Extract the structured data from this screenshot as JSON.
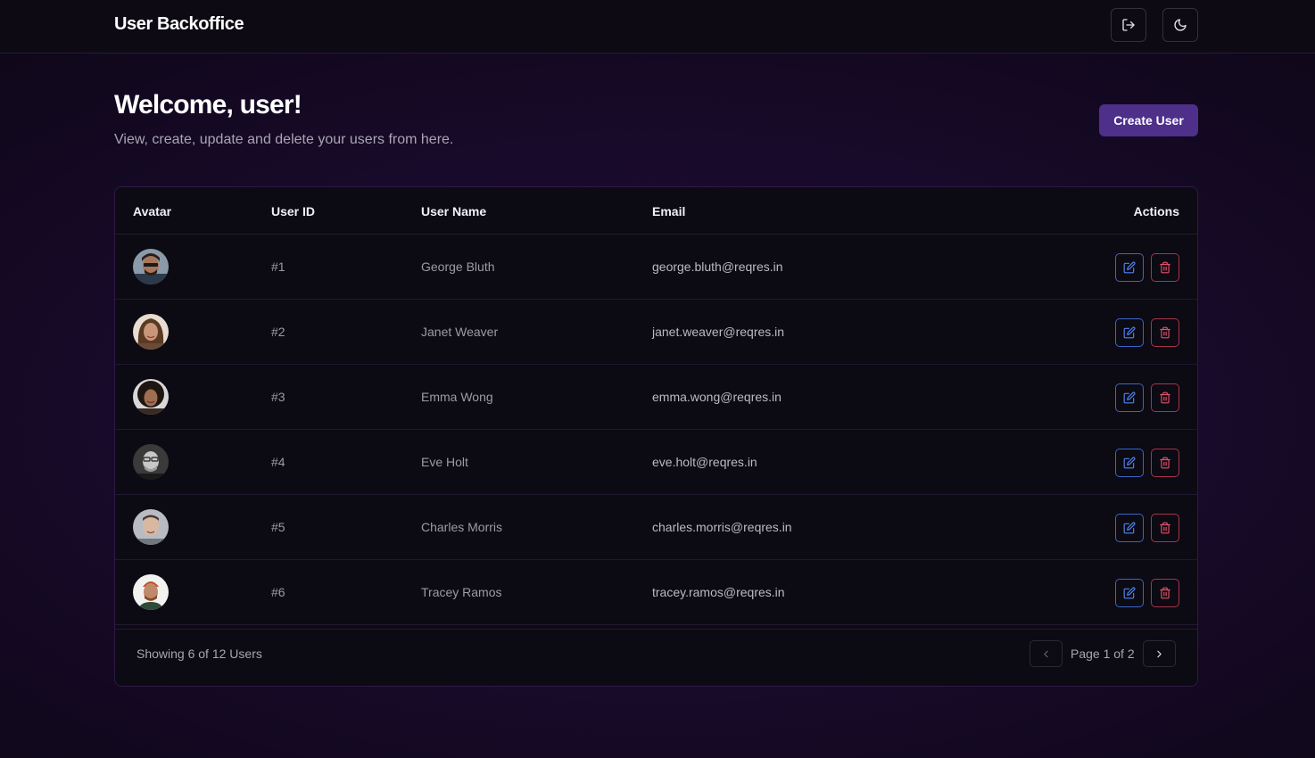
{
  "header": {
    "title": "User Backoffice",
    "logout_icon": "logout-icon",
    "theme_icon": "moon-icon"
  },
  "welcome": {
    "heading": "Welcome, user!",
    "subtitle": "View, create, update and delete your users from here."
  },
  "toolbar": {
    "create_label": "Create User"
  },
  "table": {
    "columns": [
      "Avatar",
      "User ID",
      "User Name",
      "Email",
      "Actions"
    ],
    "rows": [
      {
        "id": "#1",
        "name": "George Bluth",
        "email": "george.bluth@reqres.in"
      },
      {
        "id": "#2",
        "name": "Janet Weaver",
        "email": "janet.weaver@reqres.in"
      },
      {
        "id": "#3",
        "name": "Emma Wong",
        "email": "emma.wong@reqres.in"
      },
      {
        "id": "#4",
        "name": "Eve Holt",
        "email": "eve.holt@reqres.in"
      },
      {
        "id": "#5",
        "name": "Charles Morris",
        "email": "charles.morris@reqres.in"
      },
      {
        "id": "#6",
        "name": "Tracey Ramos",
        "email": "tracey.ramos@reqres.in"
      }
    ],
    "row_actions": {
      "edit_icon": "edit-icon",
      "delete_icon": "trash-icon"
    }
  },
  "footer": {
    "showing": "Showing 6 of 12 Users",
    "page_info": "Page 1 of 2"
  },
  "colors": {
    "accent": "#4e2f8a",
    "edit": "#4f84f5",
    "delete": "#e2526a"
  }
}
